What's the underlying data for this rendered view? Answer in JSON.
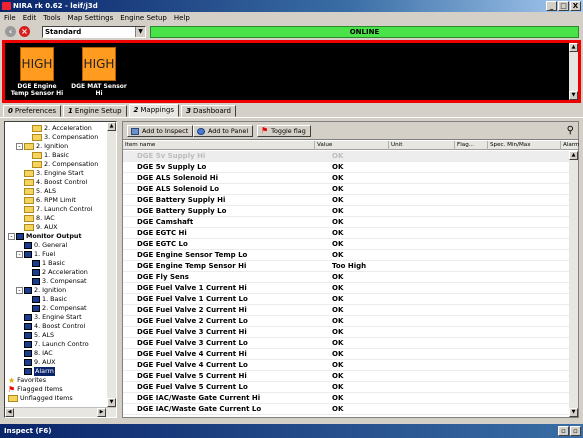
{
  "window": {
    "title": "NIRA rk 0.62 - leif/j3d",
    "min": "_",
    "max": "□",
    "close": "X"
  },
  "menu": [
    "File",
    "Edit",
    "Tools",
    "Map Settings",
    "Engine Setup",
    "Help"
  ],
  "toolbar": {
    "profile": "Standard",
    "status": "ONLINE"
  },
  "alarms": [
    {
      "text": "HIGH",
      "label": "DGE Engine Temp Sensor Hi"
    },
    {
      "text": "HIGH",
      "label": "DGE MAT Sensor Hi"
    }
  ],
  "tabs": [
    {
      "num": "0",
      "label": "Preferences"
    },
    {
      "num": "1",
      "label": "Engine Setup"
    },
    {
      "num": "2",
      "label": "Mappings"
    },
    {
      "num": "3",
      "label": "Dashboard"
    }
  ],
  "tree": [
    {
      "label": "2. Acceleration",
      "indent": 3,
      "icon": "folder"
    },
    {
      "label": "3. Compensation",
      "indent": 3,
      "icon": "folder"
    },
    {
      "label": "2. Ignition",
      "indent": 1,
      "icon": "folder",
      "exp": "-"
    },
    {
      "label": "1. Basic",
      "indent": 3,
      "icon": "folder"
    },
    {
      "label": "2. Compensation",
      "indent": 3,
      "icon": "folder"
    },
    {
      "label": "3. Engine Start",
      "indent": 2,
      "icon": "folder"
    },
    {
      "label": "4. Boost Control",
      "indent": 2,
      "icon": "folder"
    },
    {
      "label": "5. ALS",
      "indent": 2,
      "icon": "folder"
    },
    {
      "label": "6. RPM Limit",
      "indent": 2,
      "icon": "folder"
    },
    {
      "label": "7. Launch Control",
      "indent": 2,
      "icon": "folder"
    },
    {
      "label": "8. IAC",
      "indent": 2,
      "icon": "folder"
    },
    {
      "label": "9. AUX",
      "indent": 2,
      "icon": "folder"
    },
    {
      "label": "Monitor Output",
      "indent": 0,
      "icon": "mon",
      "exp": "-",
      "bold": true
    },
    {
      "label": "0. General",
      "indent": 2,
      "icon": "mon"
    },
    {
      "label": "1. Fuel",
      "indent": 1,
      "icon": "mon",
      "exp": "-"
    },
    {
      "label": "1 Basic",
      "indent": 3,
      "icon": "mon"
    },
    {
      "label": "2 Acceleration",
      "indent": 3,
      "icon": "mon"
    },
    {
      "label": "3. Compensat",
      "indent": 3,
      "icon": "mon"
    },
    {
      "label": "2. Ignition",
      "indent": 1,
      "icon": "mon",
      "exp": "-"
    },
    {
      "label": "1. Basic",
      "indent": 3,
      "icon": "mon"
    },
    {
      "label": "2. Compensat",
      "indent": 3,
      "icon": "mon"
    },
    {
      "label": "3. Engine Start",
      "indent": 2,
      "icon": "mon"
    },
    {
      "label": "4. Boost Control",
      "indent": 2,
      "icon": "mon"
    },
    {
      "label": "5. ALS",
      "indent": 2,
      "icon": "mon"
    },
    {
      "label": "7. Launch Contro",
      "indent": 2,
      "icon": "mon"
    },
    {
      "label": "8. IAC",
      "indent": 2,
      "icon": "mon"
    },
    {
      "label": "9. AUX",
      "indent": 2,
      "icon": "mon"
    },
    {
      "label": "Alarm",
      "indent": 2,
      "icon": "mon",
      "selected": true
    },
    {
      "label": "Favorites",
      "indent": 0,
      "icon": "star"
    },
    {
      "label": "Flagged Items",
      "indent": 0,
      "icon": "flag"
    },
    {
      "label": "Unflagged Items",
      "indent": 0,
      "icon": "folder"
    }
  ],
  "mappings_toolbar": {
    "add_inspect": "Add to Inspect",
    "add_panel": "Add to Panel",
    "toggle_flag": "Toggle flag"
  },
  "columns": [
    "Item name",
    "Value",
    "Unit",
    "Flag...",
    "Spec. Min/Max",
    "Alarm"
  ],
  "rows": [
    {
      "name": "DGE 5v Supply Hi",
      "value": "OK"
    },
    {
      "name": "DGE 5v Supply Lo",
      "value": "OK"
    },
    {
      "name": "DGE ALS Solenoid Hi",
      "value": "OK"
    },
    {
      "name": "DGE ALS Solenoid Lo",
      "value": "OK"
    },
    {
      "name": "DGE Battery Supply  Hi",
      "value": "OK"
    },
    {
      "name": "DGE Battery Supply Lo",
      "value": "OK"
    },
    {
      "name": "DGE Camshaft",
      "value": "OK"
    },
    {
      "name": "DGE EGTC Hi",
      "value": "OK"
    },
    {
      "name": "DGE EGTC Lo",
      "value": "OK"
    },
    {
      "name": "DGE Engine Sensor Temp Lo",
      "value": "OK"
    },
    {
      "name": "DGE Engine Temp Sensor Hi",
      "value": "Too High"
    },
    {
      "name": "DGE Fly Sens",
      "value": "OK"
    },
    {
      "name": "DGE Fuel Valve 1 Current Hi",
      "value": "OK"
    },
    {
      "name": "DGE Fuel Valve 1 Current Lo",
      "value": "OK"
    },
    {
      "name": "DGE Fuel Valve 2 Current Hi",
      "value": "OK"
    },
    {
      "name": "DGE Fuel Valve 2 Current Lo",
      "value": "OK"
    },
    {
      "name": "DGE Fuel Valve 3 Current Hi",
      "value": "OK"
    },
    {
      "name": "DGE Fuel Valve 3 Current Lo",
      "value": "OK"
    },
    {
      "name": "DGE Fuel Valve 4 Current Hi",
      "value": "OK"
    },
    {
      "name": "DGE Fuel Valve 4 Current Lo",
      "value": "OK"
    },
    {
      "name": "DGE Fuel Valve 5 Current Hi",
      "value": "OK"
    },
    {
      "name": "DGE Fuel Valve 5 Current Lo",
      "value": "OK"
    },
    {
      "name": "DGE IAC/Waste Gate Current Hi",
      "value": "OK"
    },
    {
      "name": "DGE IAC/Waste Gate Current Lo",
      "value": "OK"
    }
  ],
  "statusbar": {
    "label": "Inspect (F6)"
  }
}
